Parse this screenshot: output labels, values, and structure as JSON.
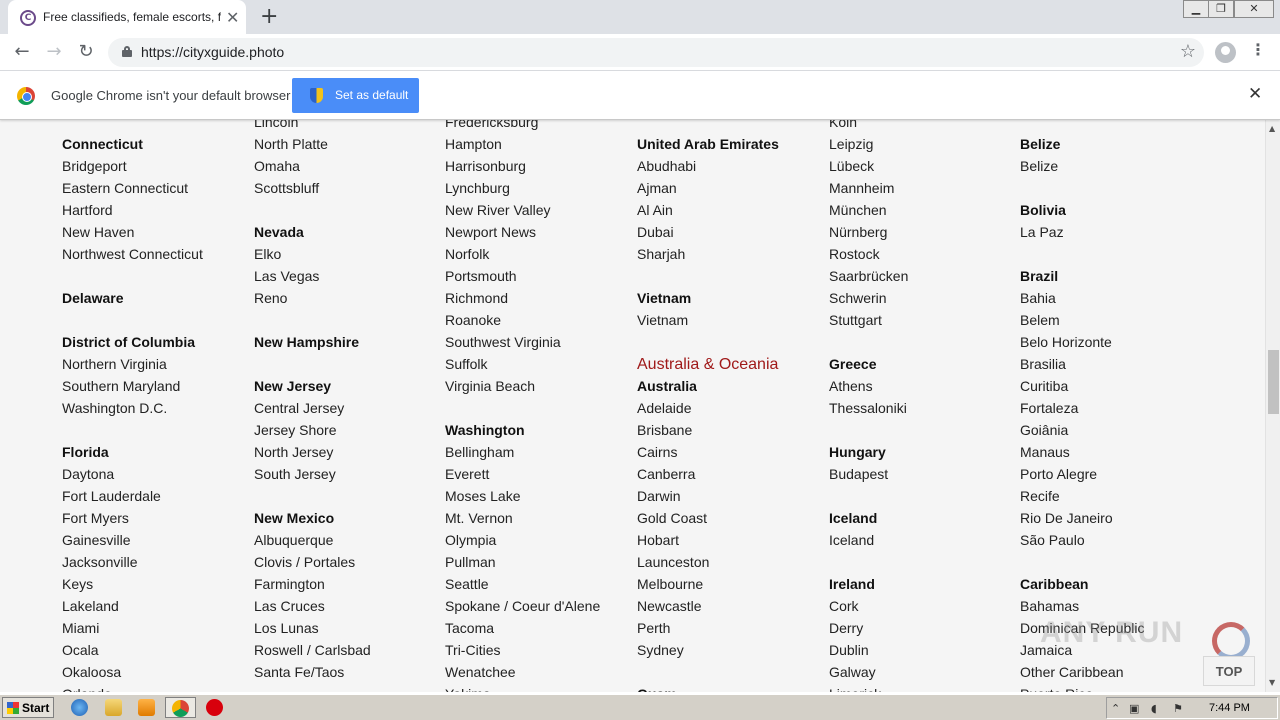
{
  "browser": {
    "tab_title": "Free classifieds, female escorts, fem",
    "tab_favicon_letter": "C",
    "tab_close": "✕",
    "new_tab": "+",
    "url": "https://cityxguide.photo",
    "window_controls": {
      "minimize": "▁",
      "restore": "❐",
      "close": "✕"
    }
  },
  "infobar": {
    "message": "Google Chrome isn't your default browser",
    "button": "Set as default",
    "close": "✕"
  },
  "columns": [
    {
      "items": [
        {
          "t": "Connecticut",
          "k": "state"
        },
        {
          "t": "Bridgeport"
        },
        {
          "t": "Eastern Connecticut"
        },
        {
          "t": "Hartford"
        },
        {
          "t": "New Haven"
        },
        {
          "t": "Northwest Connecticut"
        },
        {
          "t": "",
          "k": "gap"
        },
        {
          "t": "Delaware",
          "k": "state"
        },
        {
          "t": "",
          "k": "gap"
        },
        {
          "t": "District of Columbia",
          "k": "state"
        },
        {
          "t": "Northern Virginia"
        },
        {
          "t": "Southern Maryland"
        },
        {
          "t": "Washington D.C."
        },
        {
          "t": "",
          "k": "gap"
        },
        {
          "t": "Florida",
          "k": "state"
        },
        {
          "t": "Daytona"
        },
        {
          "t": "Fort Lauderdale"
        },
        {
          "t": "Fort Myers"
        },
        {
          "t": "Gainesville"
        },
        {
          "t": "Jacksonville"
        },
        {
          "t": "Keys"
        },
        {
          "t": "Lakeland"
        },
        {
          "t": "Miami"
        },
        {
          "t": "Ocala"
        },
        {
          "t": "Okaloosa"
        },
        {
          "t": "Orlando"
        }
      ]
    },
    {
      "items": [
        {
          "t": "Lincoln"
        },
        {
          "t": "North Platte"
        },
        {
          "t": "Omaha"
        },
        {
          "t": "Scottsbluff"
        },
        {
          "t": "",
          "k": "gap"
        },
        {
          "t": "Nevada",
          "k": "state"
        },
        {
          "t": "Elko"
        },
        {
          "t": "Las Vegas"
        },
        {
          "t": "Reno"
        },
        {
          "t": "",
          "k": "gap"
        },
        {
          "t": "New Hampshire",
          "k": "state"
        },
        {
          "t": "",
          "k": "gap"
        },
        {
          "t": "New Jersey",
          "k": "state"
        },
        {
          "t": "Central Jersey"
        },
        {
          "t": "Jersey Shore"
        },
        {
          "t": "North Jersey"
        },
        {
          "t": "South Jersey"
        },
        {
          "t": "",
          "k": "gap"
        },
        {
          "t": "New Mexico",
          "k": "state"
        },
        {
          "t": "Albuquerque"
        },
        {
          "t": "Clovis / Portales"
        },
        {
          "t": "Farmington"
        },
        {
          "t": "Las Cruces"
        },
        {
          "t": "Los Lunas"
        },
        {
          "t": "Roswell / Carlsbad"
        },
        {
          "t": "Santa Fe/Taos"
        }
      ]
    },
    {
      "items": [
        {
          "t": "Fredericksburg"
        },
        {
          "t": "Hampton"
        },
        {
          "t": "Harrisonburg"
        },
        {
          "t": "Lynchburg"
        },
        {
          "t": "New River Valley"
        },
        {
          "t": "Newport News"
        },
        {
          "t": "Norfolk"
        },
        {
          "t": "Portsmouth"
        },
        {
          "t": "Richmond"
        },
        {
          "t": "Roanoke"
        },
        {
          "t": "Southwest Virginia"
        },
        {
          "t": "Suffolk"
        },
        {
          "t": "Virginia Beach"
        },
        {
          "t": "",
          "k": "gap"
        },
        {
          "t": "Washington",
          "k": "state"
        },
        {
          "t": "Bellingham"
        },
        {
          "t": "Everett"
        },
        {
          "t": "Moses Lake"
        },
        {
          "t": "Mt. Vernon"
        },
        {
          "t": "Olympia"
        },
        {
          "t": "Pullman"
        },
        {
          "t": "Seattle"
        },
        {
          "t": "Spokane / Coeur d'Alene"
        },
        {
          "t": "Tacoma"
        },
        {
          "t": "Tri-Cities"
        },
        {
          "t": "Wenatchee"
        },
        {
          "t": "Yakima"
        }
      ]
    },
    {
      "items": [
        {
          "t": "",
          "k": "gap"
        },
        {
          "t": "United Arab Emirates",
          "k": "state"
        },
        {
          "t": "Abudhabi"
        },
        {
          "t": "Ajman"
        },
        {
          "t": "Al Ain"
        },
        {
          "t": "Dubai"
        },
        {
          "t": "Sharjah"
        },
        {
          "t": "",
          "k": "gap"
        },
        {
          "t": "Vietnam",
          "k": "state"
        },
        {
          "t": "Vietnam"
        },
        {
          "t": "",
          "k": "gap"
        },
        {
          "t": "Australia & Oceania",
          "k": "region"
        },
        {
          "t": "Australia",
          "k": "state"
        },
        {
          "t": "Adelaide"
        },
        {
          "t": "Brisbane"
        },
        {
          "t": "Cairns"
        },
        {
          "t": "Canberra"
        },
        {
          "t": "Darwin"
        },
        {
          "t": "Gold Coast"
        },
        {
          "t": "Hobart"
        },
        {
          "t": "Launceston"
        },
        {
          "t": "Melbourne"
        },
        {
          "t": "Newcastle"
        },
        {
          "t": "Perth"
        },
        {
          "t": "Sydney"
        },
        {
          "t": "",
          "k": "gap"
        },
        {
          "t": "Guam",
          "k": "state"
        }
      ]
    },
    {
      "items": [
        {
          "t": "Köln"
        },
        {
          "t": "Leipzig"
        },
        {
          "t": "Lübeck"
        },
        {
          "t": "Mannheim"
        },
        {
          "t": "München"
        },
        {
          "t": "Nürnberg"
        },
        {
          "t": "Rostock"
        },
        {
          "t": "Saarbrücken"
        },
        {
          "t": "Schwerin"
        },
        {
          "t": "Stuttgart"
        },
        {
          "t": "",
          "k": "gap"
        },
        {
          "t": "Greece",
          "k": "state"
        },
        {
          "t": "Athens"
        },
        {
          "t": "Thessaloniki"
        },
        {
          "t": "",
          "k": "gap"
        },
        {
          "t": "Hungary",
          "k": "state"
        },
        {
          "t": "Budapest"
        },
        {
          "t": "",
          "k": "gap"
        },
        {
          "t": "Iceland",
          "k": "state"
        },
        {
          "t": "Iceland"
        },
        {
          "t": "",
          "k": "gap"
        },
        {
          "t": "Ireland",
          "k": "state"
        },
        {
          "t": "Cork"
        },
        {
          "t": "Derry"
        },
        {
          "t": "Dublin"
        },
        {
          "t": "Galway"
        },
        {
          "t": "Limerick"
        }
      ]
    },
    {
      "items": [
        {
          "t": "",
          "k": "gap"
        },
        {
          "t": "Belize",
          "k": "state"
        },
        {
          "t": "Belize"
        },
        {
          "t": "",
          "k": "gap"
        },
        {
          "t": "Bolivia",
          "k": "state"
        },
        {
          "t": "La Paz"
        },
        {
          "t": "",
          "k": "gap"
        },
        {
          "t": "Brazil",
          "k": "state"
        },
        {
          "t": "Bahia"
        },
        {
          "t": "Belem"
        },
        {
          "t": "Belo Horizonte"
        },
        {
          "t": "Brasilia"
        },
        {
          "t": "Curitiba"
        },
        {
          "t": "Fortaleza"
        },
        {
          "t": "Goiânia"
        },
        {
          "t": "Manaus"
        },
        {
          "t": "Porto Alegre"
        },
        {
          "t": "Recife"
        },
        {
          "t": "Rio De Janeiro"
        },
        {
          "t": "São Paulo"
        },
        {
          "t": "",
          "k": "gap"
        },
        {
          "t": "Caribbean",
          "k": "state"
        },
        {
          "t": "Bahamas"
        },
        {
          "t": "Dominican Republic"
        },
        {
          "t": "Jamaica"
        },
        {
          "t": "Other Caribbean"
        },
        {
          "t": "Puerto Rico"
        }
      ]
    }
  ],
  "top_button": "TOP",
  "watermark": "ANY RUN",
  "taskbar": {
    "start": "Start",
    "clock": "7:44 PM"
  }
}
